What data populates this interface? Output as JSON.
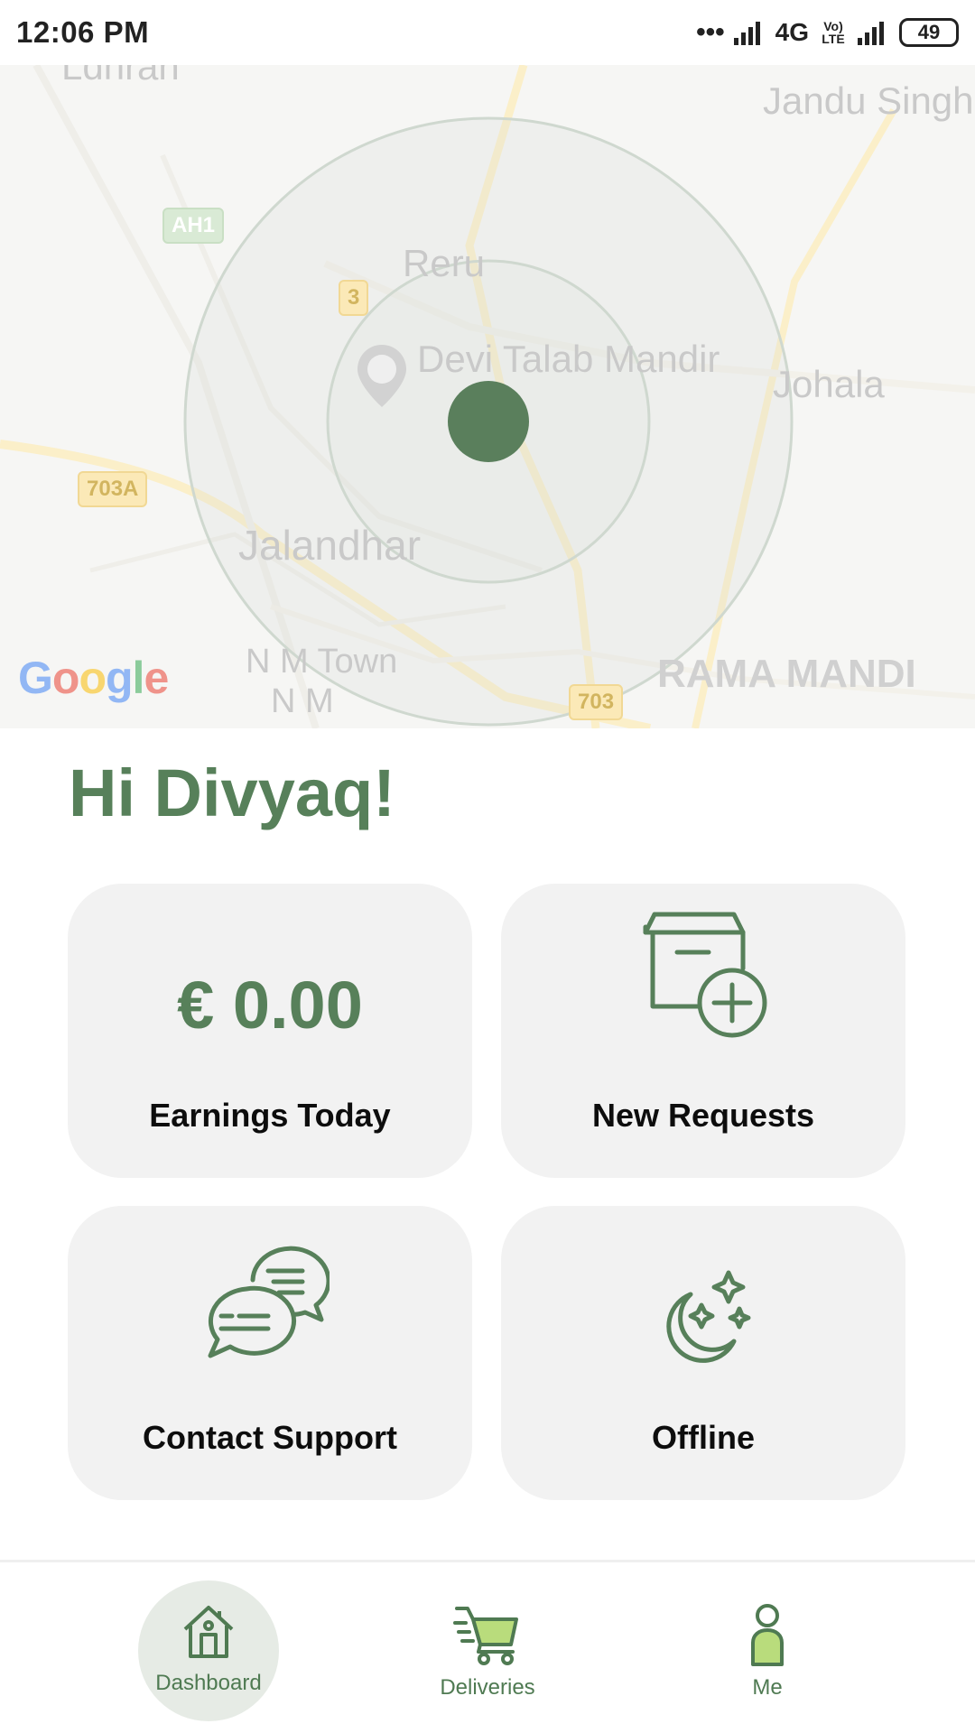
{
  "status_bar": {
    "time": "12:06 PM",
    "network": "4G",
    "volte": "Vo) LTE",
    "battery": "49"
  },
  "map": {
    "labels": {
      "top_left": "Ldhran",
      "jandu": "Jandu Singha",
      "reru": "Reru",
      "mandir": "Devi Talab Mandir",
      "johala": "Johala",
      "jalandhar": "Jalandhar",
      "nm_town": "N M Town",
      "nm": "N M",
      "rama_mandi": "RAMA MANDI"
    },
    "shields": {
      "ah1": "AH1",
      "r3": "3",
      "r703a": "703A",
      "r703": "703"
    },
    "attribution": "Google",
    "colors": {
      "location_dot": "#5a7f5c",
      "radius_ring": "#cfd8cf"
    }
  },
  "greeting": "Hi Divyaq!",
  "cards": {
    "earnings": {
      "value": "€ 0.00",
      "label": "Earnings Today"
    },
    "requests": {
      "label": "New Requests",
      "icon": "box-plus-icon"
    },
    "support": {
      "label": "Contact Support",
      "icon": "chat-bubbles-icon"
    },
    "offline": {
      "label": "Offline",
      "icon": "moon-stars-icon"
    }
  },
  "bottom_nav": {
    "active": "dashboard",
    "items": [
      {
        "id": "dashboard",
        "label": "Dashboard",
        "icon": "home-icon"
      },
      {
        "id": "deliveries",
        "label": "Deliveries",
        "icon": "cart-icon"
      },
      {
        "id": "me",
        "label": "Me",
        "icon": "person-icon"
      }
    ]
  },
  "colors": {
    "accent": "#57805a",
    "card_bg": "#f2f2f2",
    "cart_fill": "#b9dc7c"
  }
}
